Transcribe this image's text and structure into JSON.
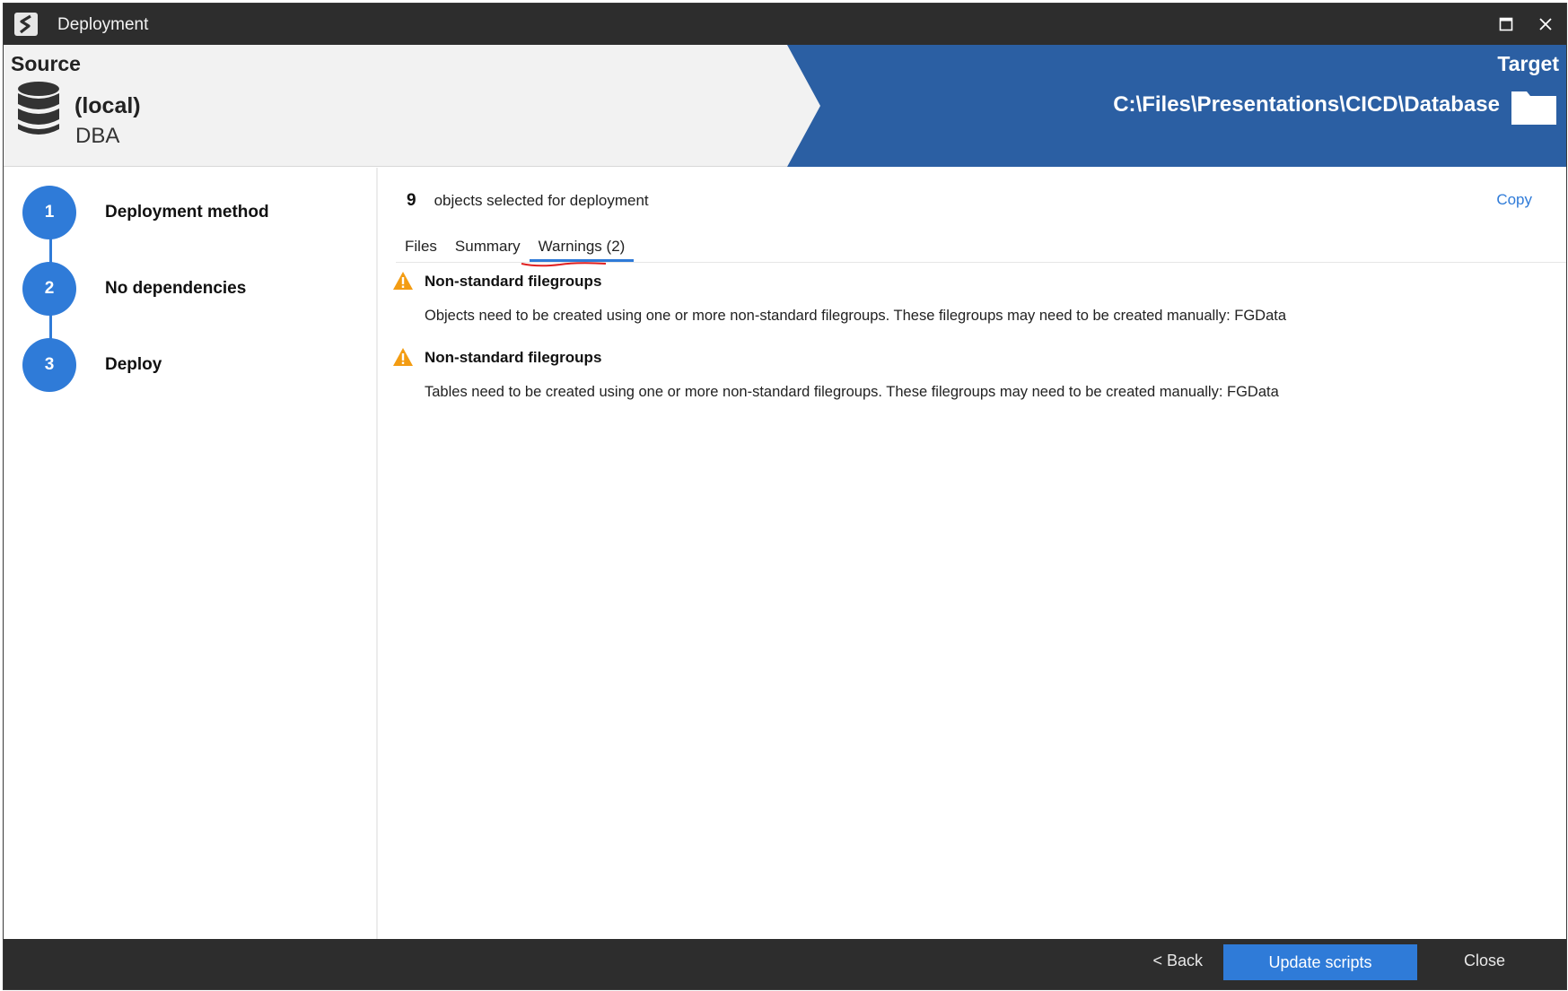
{
  "window": {
    "title": "Deployment"
  },
  "source": {
    "heading": "Source",
    "server": "(local)",
    "database": "DBA"
  },
  "target": {
    "heading": "Target",
    "path": "C:\\Files\\Presentations\\CICD\\Database"
  },
  "steps": [
    {
      "number": "1",
      "label": "Deployment method"
    },
    {
      "number": "2",
      "label": "No dependencies"
    },
    {
      "number": "3",
      "label": "Deploy"
    }
  ],
  "selection": {
    "count": "9",
    "text": "objects selected for deployment",
    "copy_label": "Copy"
  },
  "tabs": [
    {
      "label": "Files"
    },
    {
      "label": "Summary"
    },
    {
      "label": "Warnings (2)"
    }
  ],
  "warnings": [
    {
      "title": "Non-standard filegroups",
      "message": "Objects need to be created using one or more non-standard filegroups. These filegroups may need to be created manually: FGData"
    },
    {
      "title": "Non-standard filegroups",
      "message": "Tables need to be created using one or more non-standard filegroups. These filegroups may need to be created manually: FGData"
    }
  ],
  "footer": {
    "back_label": "< Back",
    "update_label": "Update scripts",
    "close_label": "Close"
  },
  "colors": {
    "accent": "#2f7bd8",
    "target_band": "#2b5fa3",
    "titlebar": "#2d2d2d",
    "warning": "#f39c12"
  }
}
